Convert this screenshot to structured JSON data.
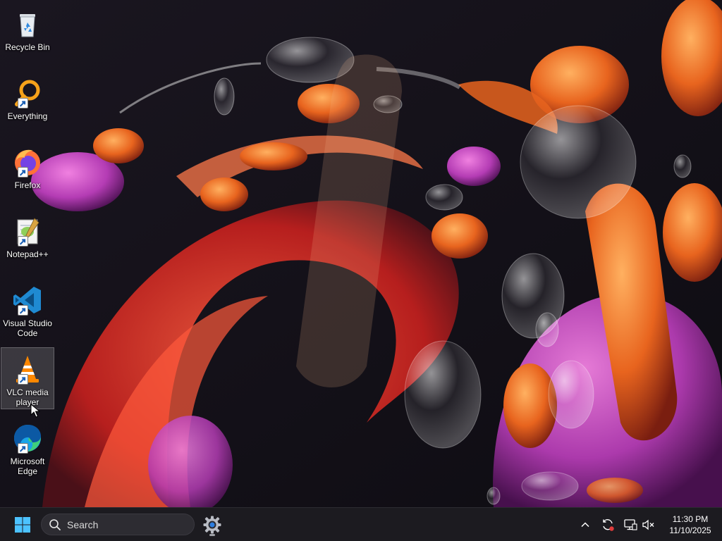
{
  "desktop": {
    "icons": [
      {
        "label": "Recycle Bin",
        "icon": "recycle-bin-icon",
        "shortcut": false
      },
      {
        "label": "Everything",
        "icon": "everything-search-icon",
        "shortcut": true
      },
      {
        "label": "Firefox",
        "icon": "firefox-icon",
        "shortcut": true
      },
      {
        "label": "Notepad++",
        "icon": "notepad-plus-plus-icon",
        "shortcut": true
      },
      {
        "label": "Visual Studio Code",
        "icon": "vscode-icon",
        "shortcut": true
      },
      {
        "label": "VLC media player",
        "icon": "vlc-cone-icon",
        "shortcut": true
      },
      {
        "label": "Microsoft Edge",
        "icon": "edge-icon",
        "shortcut": true
      }
    ],
    "selected_icon": "VLC media player"
  },
  "taskbar": {
    "start_icon": "windows-logo-icon",
    "search": {
      "placeholder": "Search",
      "icon": "search-icon"
    },
    "pinned_apps": [
      {
        "name": "Settings",
        "icon": "gear-icon",
        "running": true
      }
    ],
    "tray": {
      "icons": [
        "chevron-up-icon",
        "sync-icon",
        "network-icon",
        "speaker-muted-icon"
      ],
      "time": "11:30 PM",
      "date": "11/10/2025"
    }
  },
  "colors": {
    "taskbar_bg": "#1c1b20",
    "search_bg": "#2d2c32",
    "accent_blue": "#0078d4",
    "wallpaper_orange": "#e8641e",
    "wallpaper_magenta": "#b43cb4"
  }
}
